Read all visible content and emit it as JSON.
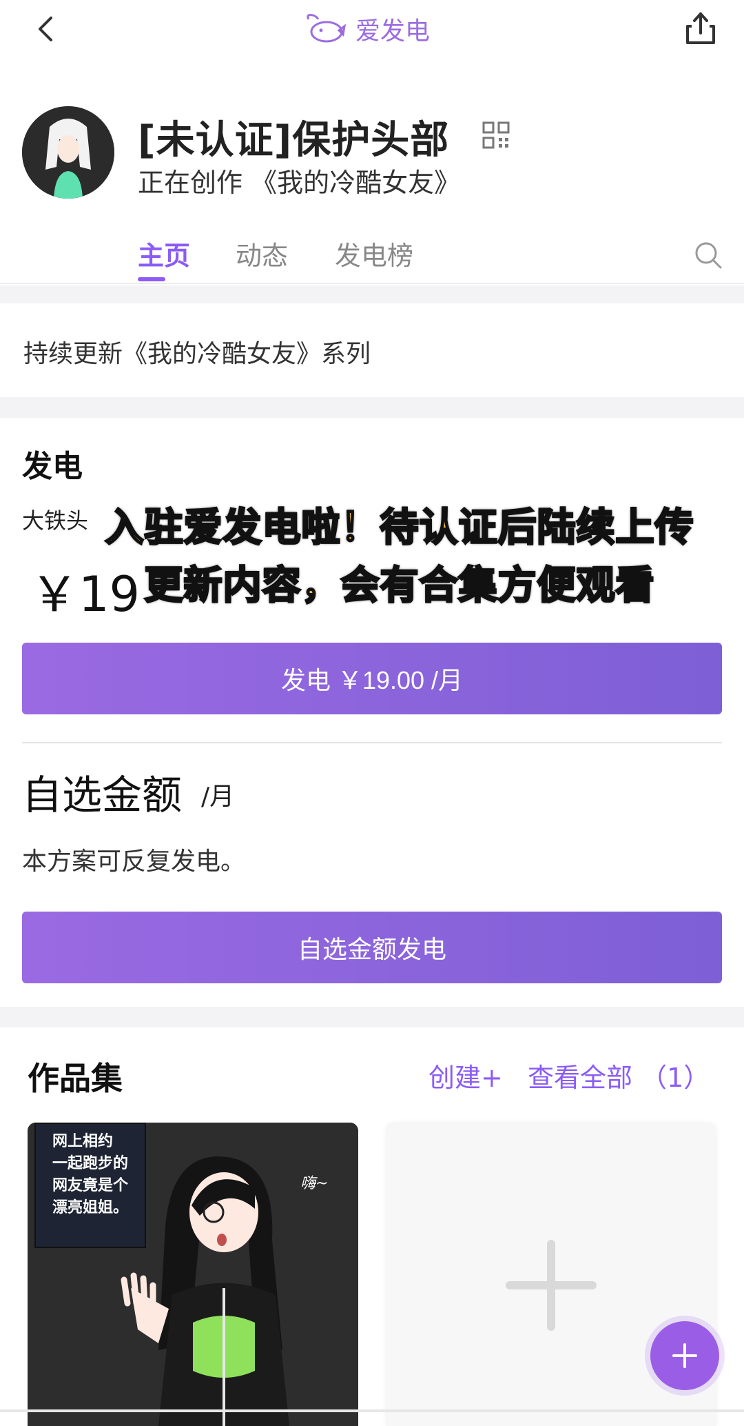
{
  "header": {
    "brand": "爱发电"
  },
  "profile": {
    "name": "[未认证]保护头部",
    "creating": "正在创作 《我的冷酷女友》"
  },
  "tabs": [
    {
      "label": "主页",
      "active": true
    },
    {
      "label": "动态",
      "active": false
    },
    {
      "label": "发电榜",
      "active": false
    }
  ],
  "intro": "持续更新《我的冷酷女友》系列",
  "power": {
    "title": "发电",
    "plan_name": "大铁头",
    "plan_price_visible": "￥19",
    "overlay_line1": "入驻爱发电啦！待认证后陆续上传",
    "overlay_line2": "更新内容，会有合集方便观看",
    "button_label": "发电 ￥19.00 /月",
    "custom_title": "自选金额",
    "custom_unit": "/月",
    "custom_desc": "本方案可反复发电。",
    "custom_button_label": "自选金额发电"
  },
  "works": {
    "title": "作品集",
    "create_label": "创建+",
    "view_all_label": "查看全部 （1）",
    "cover_caption": [
      "网上相约",
      "一起跑步的",
      "网友竟是个",
      "漂亮姐姐。"
    ],
    "cover_bubble": "嗨~"
  },
  "colors": {
    "accent": "#8b5cf6",
    "button": "#8f64de",
    "overlay_text": "#f8c53a"
  }
}
